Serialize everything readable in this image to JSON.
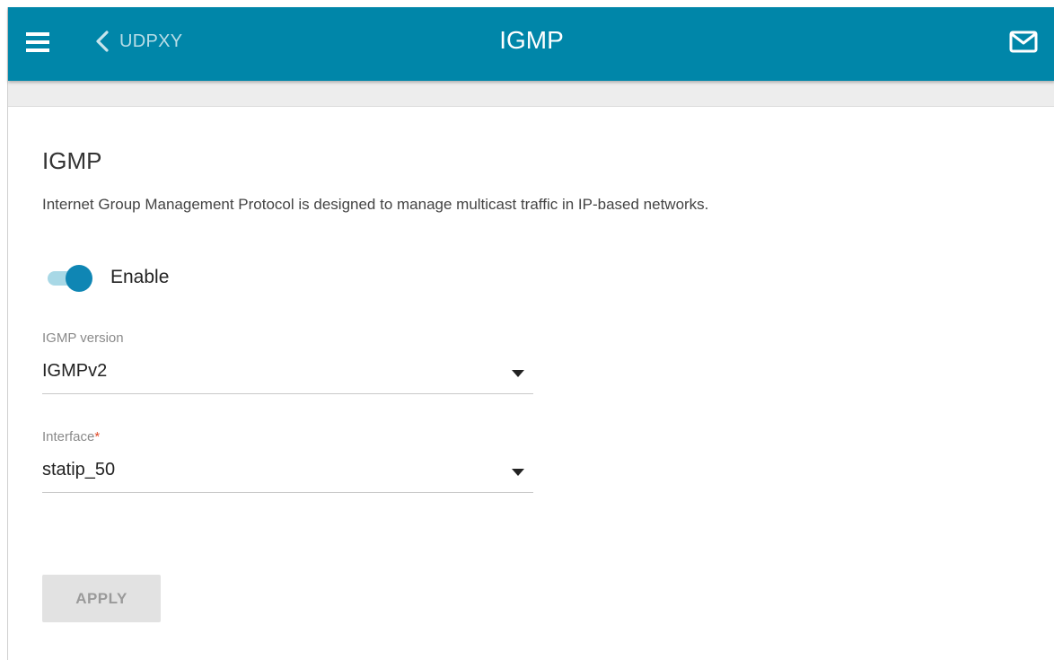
{
  "header": {
    "back_label": "UDPXY",
    "title": "IGMP",
    "background_color": "#0086a9",
    "icons": [
      "menu-icon",
      "chevron-left-icon",
      "mail-icon"
    ]
  },
  "section": {
    "title": "IGMP",
    "description": "Internet Group Management Protocol is designed to manage multicast traffic in IP-based networks."
  },
  "enable_toggle": {
    "label": "Enable",
    "checked": true,
    "accent_color": "#0f86b4"
  },
  "fields": {
    "igmp_version": {
      "label": "IGMP version",
      "value": "IGMPv2"
    },
    "interface": {
      "label": "Interface",
      "required_mark": "*",
      "value": "statip_50"
    }
  },
  "actions": {
    "apply_label": "APPLY",
    "apply_enabled": false
  }
}
